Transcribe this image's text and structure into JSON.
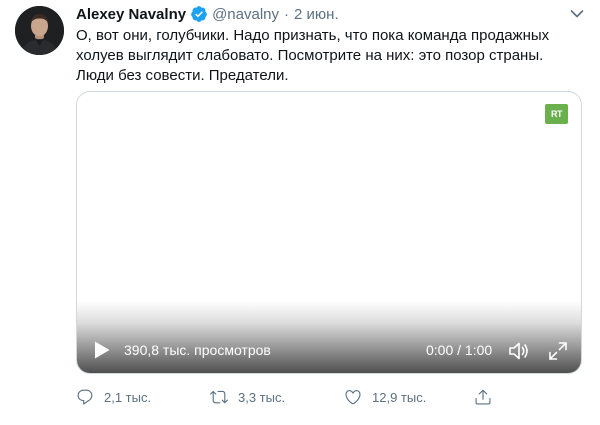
{
  "tweet": {
    "author_name": "Alexey Navalny",
    "handle": "@navalny",
    "separator": "·",
    "date": "2 июн.",
    "text": "О, вот они, голубчики. Надо признать, что пока команда продажных холуев выглядит слабовато. Посмотрите на них: это позор страны. Люди без совести. Предатели.",
    "verified_icon": "verified-badge-icon",
    "more_icon": "chevron-down-icon"
  },
  "video": {
    "watermark": "RT",
    "views_label": "390,8 тыс. просмотров",
    "time_label": "0:00 / 1:00",
    "play_icon": "play-icon",
    "volume_icon": "volume-icon",
    "fullscreen_icon": "fullscreen-icon"
  },
  "actions": {
    "reply_count": "2,1 тыс.",
    "retweet_count": "3,3 тыс.",
    "like_count": "12,9 тыс.",
    "reply_icon": "reply-icon",
    "retweet_icon": "retweet-icon",
    "like_icon": "heart-icon",
    "share_icon": "share-icon"
  },
  "colors": {
    "verified": "#1da1f2",
    "secondary_text": "#5b7083",
    "rt_green": "#6ab04c",
    "border": "#cfd9de"
  }
}
